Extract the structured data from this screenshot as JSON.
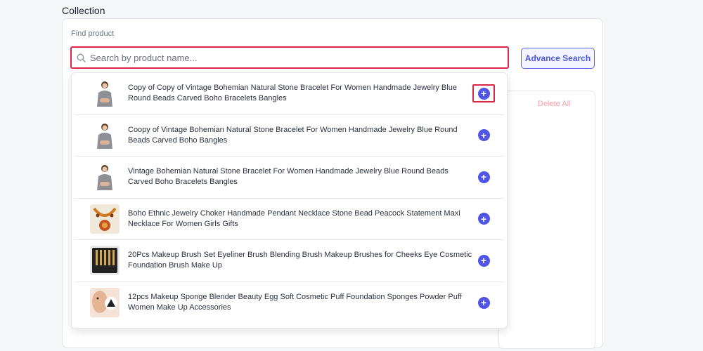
{
  "page": {
    "section_title": "Collection"
  },
  "search": {
    "label": "Find product",
    "placeholder": "Search by product name...",
    "value": ""
  },
  "advance_search_label": "Advance Search",
  "delete_all_label": "Delete All",
  "results": [
    {
      "title": "Copy of Copy of Vintage Bohemian Natural Stone Bracelet For Women Handmade Jewelry Blue Round Beads Carved Boho Bracelets Bangles",
      "thumb": "woman"
    },
    {
      "title": "Coopy of Vintage Bohemian Natural Stone Bracelet For Women Handmade Jewelry Blue Round Beads Carved Boho Bangles",
      "thumb": "woman"
    },
    {
      "title": "Vintage Bohemian Natural Stone Bracelet For Women Handmade Jewelry Blue Round Beads Carved Boho Bracelets Bangles",
      "thumb": "woman"
    },
    {
      "title": "Boho Ethnic Jewelry Choker Handmade Pendant Necklace Stone Bead Peacock Statement Maxi Necklace For Women Girls Gifts",
      "thumb": "necklace"
    },
    {
      "title": "20Pcs Makeup Brush Set Eyeliner Brush Blending Brush Makeup Brushes for Cheeks Eye Cosmetic Foundation Brush Make Up",
      "thumb": "brushes"
    },
    {
      "title": "12pcs Makeup Sponge Blender Beauty Egg Soft Cosmetic Puff Foundation Sponges Powder Puff Women Make Up Accessories",
      "thumb": "sponge"
    }
  ],
  "add_icon_glyph": "+",
  "colors": {
    "accent": "#4f55e8",
    "highlight": "#dc2648",
    "delete": "#f2a0a8"
  }
}
